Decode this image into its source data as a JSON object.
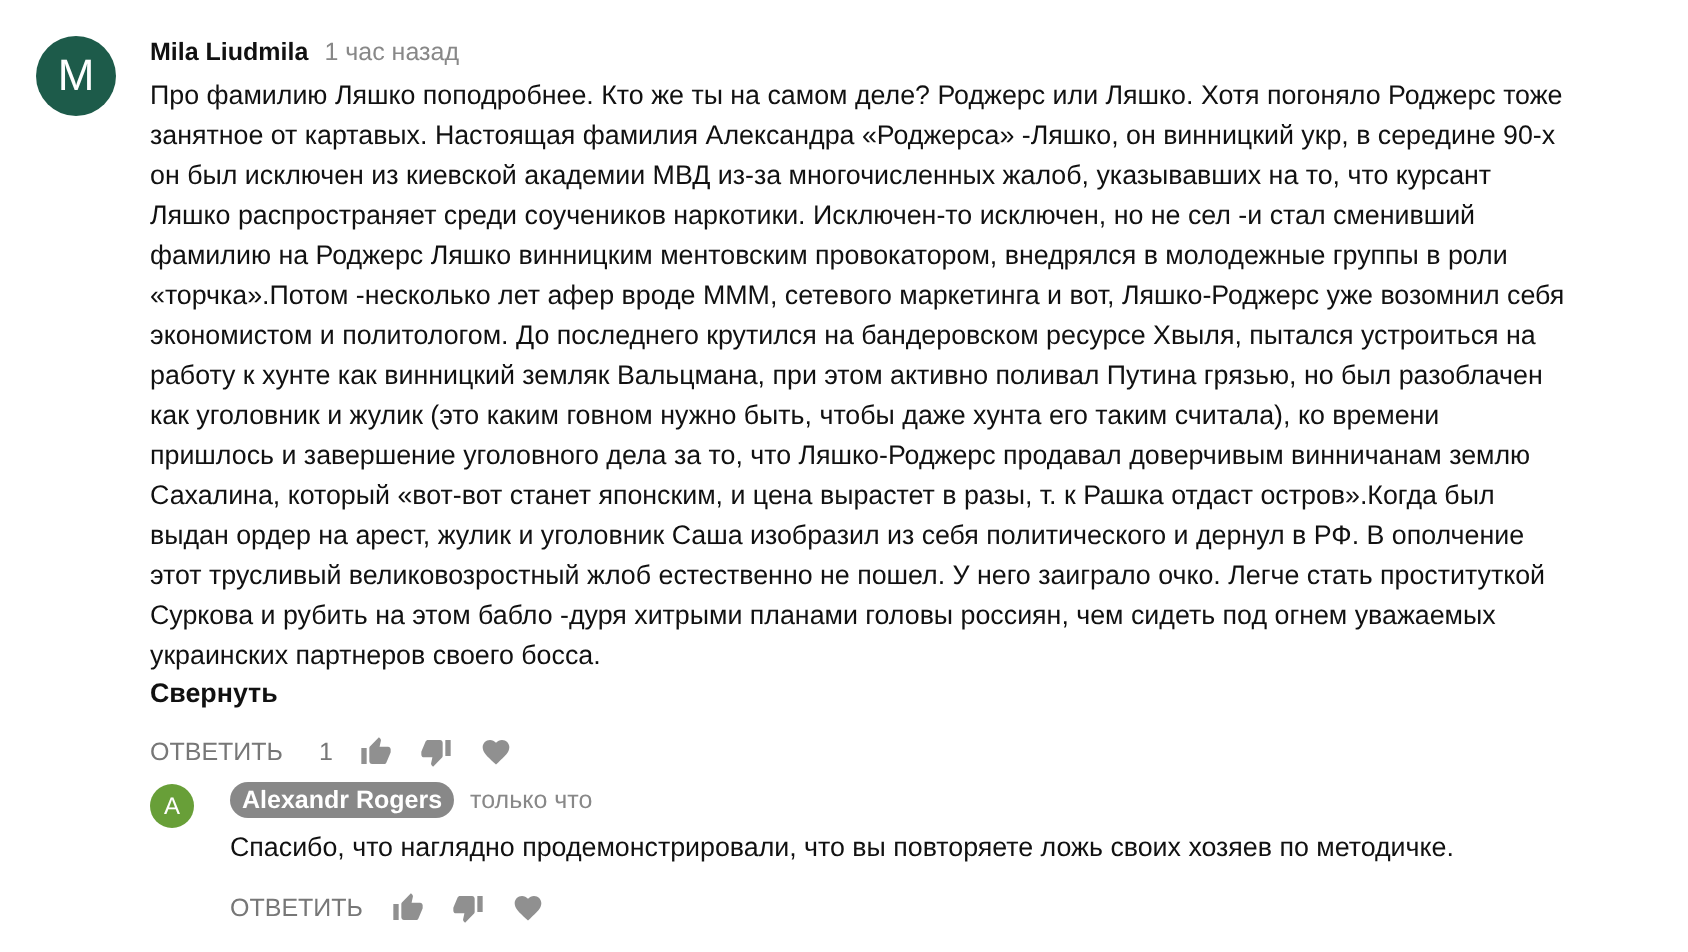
{
  "comment": {
    "avatar_letter": "M",
    "author": "Mila Liudmila",
    "time": "1 час назад",
    "lines": [
      "Про фамилию Ляшко поподробнее. Кто же ты на самом деле? Роджерс или Ляшко. Хотя погоняло Роджерс тоже",
      "занятное от картавых. Настоящая фамилия Александра «Роджерса» -Ляшко, он винницкий укр, в середине 90-х",
      "он был исключен из киевской академии МВД из-за многочисленных жалоб, указывавших на то, что курсант",
      "Ляшко распространяет среди соучеников наркотики. Исключен-то исключен, но не сел -и стал сменивший",
      "фамилию на Роджерс Ляшко винницким ментовским провокатором, внедрялся в молодежные группы в роли",
      "«торчка».Потом -несколько лет афер вроде МММ, сетевого маркетинга и вот, Ляшко-Роджерс уже возомнил себя",
      "экономистом и политологом. До последнего крутился на бандеровском ресурсе Хвыля, пытался устроиться на",
      "работу к хунте как винницкий земляк Вальцмана, при этом активно поливал Путина грязью, но был разоблачен",
      "как уголовник и жулик (это каким говном нужно быть, чтобы даже хунта его таким считала), ко времени",
      "пришлось и завершение уголовного дела за то, что Ляшко-Роджерс продавал доверчивым винничанам землю",
      "Сахалина, который «вот-вот станет японским, и цена вырастет в разы, т. к Рашка отдаст остров».Когда был",
      "выдан ордер на арест, жулик и уголовник Саша изобразил из себя политического и дернул в РФ. В ополчение",
      "этот трусливый великовозростный жлоб естественно не пошел. У него заиграло очко. Легче стать проституткой",
      "Суркова и рубить на этом бабло -дуря хитрыми планами головы россиян, чем сидеть под огнем уважаемых",
      "украинских партнеров своего босса."
    ],
    "collapse": "Свернуть",
    "reply_button": "ОТВЕТИТЬ",
    "likes": "1"
  },
  "reply": {
    "avatar_letter": "A",
    "author": "Alexandr Rogers",
    "time": "только что",
    "text": "Спасибо, что наглядно продемонстрировали, что вы повторяете ложь своих хозяев по методичке.",
    "reply_button": "ОТВЕТИТЬ"
  }
}
